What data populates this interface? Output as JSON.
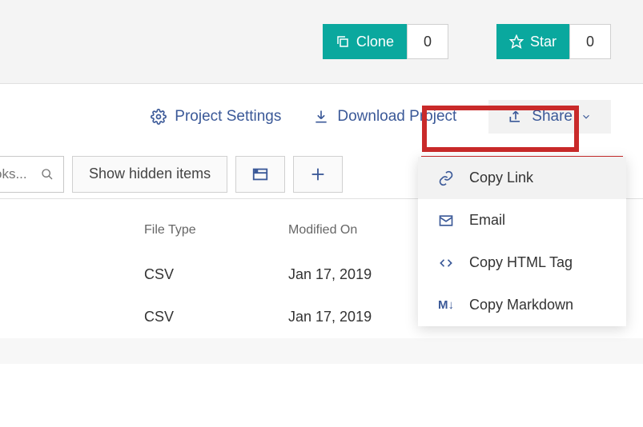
{
  "topbar": {
    "clone": {
      "label": "Clone",
      "count": "0"
    },
    "star": {
      "label": "Star",
      "count": "0"
    }
  },
  "actions": {
    "settings": "Project Settings",
    "download": "Download Project",
    "share": "Share"
  },
  "toolbar": {
    "search_placeholder": "oks...",
    "hidden": "Show hidden items"
  },
  "share_menu": {
    "copy_link": "Copy Link",
    "email": "Email",
    "copy_html": "Copy HTML Tag",
    "copy_md": "Copy Markdown"
  },
  "table": {
    "headers": {
      "filetype": "File Type",
      "modified": "Modified On"
    },
    "rows": [
      {
        "type": "CSV",
        "modified": "Jan 17, 2019"
      },
      {
        "type": "CSV",
        "modified": "Jan 17, 2019"
      }
    ]
  }
}
